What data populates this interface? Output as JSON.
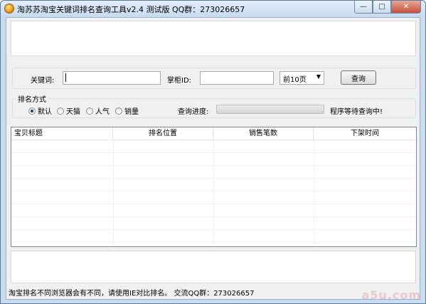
{
  "window": {
    "title": "淘苏苏淘宝关键词排名查询工具v2.4 测试版 QQ群：273026657",
    "minimize_label": "—",
    "maximize_label": "□",
    "close_label": "✕"
  },
  "search": {
    "keyword_label": "关键词:",
    "keyword_value": "",
    "shop_label": "掌柜ID:",
    "shop_value": "",
    "pages_select": "前10页",
    "query_button": "查询"
  },
  "rank": {
    "group_title": "排名方式",
    "options": [
      {
        "label": "默认",
        "checked": true
      },
      {
        "label": "天猫",
        "checked": false
      },
      {
        "label": "人气",
        "checked": false
      },
      {
        "label": "销量",
        "checked": false
      }
    ],
    "progress_label": "查询进度:",
    "progress_value": 0,
    "status_text": "程序等待查询中!"
  },
  "table": {
    "columns": [
      "宝贝标题",
      "排名位置",
      "销售笔数",
      "下架时间"
    ],
    "rows": []
  },
  "footer": {
    "text": "淘宝排名不同浏览器会有不同，请使用IE对比排名。 交流QQ群：273026657"
  },
  "watermark": "a5u.com"
}
